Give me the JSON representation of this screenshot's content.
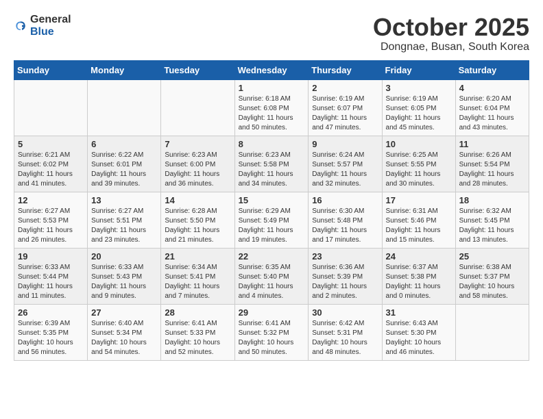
{
  "header": {
    "logo": {
      "general": "General",
      "blue": "Blue"
    },
    "title": "October 2025",
    "subtitle": "Dongnae, Busan, South Korea"
  },
  "calendar": {
    "days_of_week": [
      "Sunday",
      "Monday",
      "Tuesday",
      "Wednesday",
      "Thursday",
      "Friday",
      "Saturday"
    ],
    "weeks": [
      [
        {
          "day": "",
          "info": ""
        },
        {
          "day": "",
          "info": ""
        },
        {
          "day": "",
          "info": ""
        },
        {
          "day": "1",
          "info": "Sunrise: 6:18 AM\nSunset: 6:08 PM\nDaylight: 11 hours\nand 50 minutes."
        },
        {
          "day": "2",
          "info": "Sunrise: 6:19 AM\nSunset: 6:07 PM\nDaylight: 11 hours\nand 47 minutes."
        },
        {
          "day": "3",
          "info": "Sunrise: 6:19 AM\nSunset: 6:05 PM\nDaylight: 11 hours\nand 45 minutes."
        },
        {
          "day": "4",
          "info": "Sunrise: 6:20 AM\nSunset: 6:04 PM\nDaylight: 11 hours\nand 43 minutes."
        }
      ],
      [
        {
          "day": "5",
          "info": "Sunrise: 6:21 AM\nSunset: 6:02 PM\nDaylight: 11 hours\nand 41 minutes."
        },
        {
          "day": "6",
          "info": "Sunrise: 6:22 AM\nSunset: 6:01 PM\nDaylight: 11 hours\nand 39 minutes."
        },
        {
          "day": "7",
          "info": "Sunrise: 6:23 AM\nSunset: 6:00 PM\nDaylight: 11 hours\nand 36 minutes."
        },
        {
          "day": "8",
          "info": "Sunrise: 6:23 AM\nSunset: 5:58 PM\nDaylight: 11 hours\nand 34 minutes."
        },
        {
          "day": "9",
          "info": "Sunrise: 6:24 AM\nSunset: 5:57 PM\nDaylight: 11 hours\nand 32 minutes."
        },
        {
          "day": "10",
          "info": "Sunrise: 6:25 AM\nSunset: 5:55 PM\nDaylight: 11 hours\nand 30 minutes."
        },
        {
          "day": "11",
          "info": "Sunrise: 6:26 AM\nSunset: 5:54 PM\nDaylight: 11 hours\nand 28 minutes."
        }
      ],
      [
        {
          "day": "12",
          "info": "Sunrise: 6:27 AM\nSunset: 5:53 PM\nDaylight: 11 hours\nand 26 minutes."
        },
        {
          "day": "13",
          "info": "Sunrise: 6:27 AM\nSunset: 5:51 PM\nDaylight: 11 hours\nand 23 minutes."
        },
        {
          "day": "14",
          "info": "Sunrise: 6:28 AM\nSunset: 5:50 PM\nDaylight: 11 hours\nand 21 minutes."
        },
        {
          "day": "15",
          "info": "Sunrise: 6:29 AM\nSunset: 5:49 PM\nDaylight: 11 hours\nand 19 minutes."
        },
        {
          "day": "16",
          "info": "Sunrise: 6:30 AM\nSunset: 5:48 PM\nDaylight: 11 hours\nand 17 minutes."
        },
        {
          "day": "17",
          "info": "Sunrise: 6:31 AM\nSunset: 5:46 PM\nDaylight: 11 hours\nand 15 minutes."
        },
        {
          "day": "18",
          "info": "Sunrise: 6:32 AM\nSunset: 5:45 PM\nDaylight: 11 hours\nand 13 minutes."
        }
      ],
      [
        {
          "day": "19",
          "info": "Sunrise: 6:33 AM\nSunset: 5:44 PM\nDaylight: 11 hours\nand 11 minutes."
        },
        {
          "day": "20",
          "info": "Sunrise: 6:33 AM\nSunset: 5:43 PM\nDaylight: 11 hours\nand 9 minutes."
        },
        {
          "day": "21",
          "info": "Sunrise: 6:34 AM\nSunset: 5:41 PM\nDaylight: 11 hours\nand 7 minutes."
        },
        {
          "day": "22",
          "info": "Sunrise: 6:35 AM\nSunset: 5:40 PM\nDaylight: 11 hours\nand 4 minutes."
        },
        {
          "day": "23",
          "info": "Sunrise: 6:36 AM\nSunset: 5:39 PM\nDaylight: 11 hours\nand 2 minutes."
        },
        {
          "day": "24",
          "info": "Sunrise: 6:37 AM\nSunset: 5:38 PM\nDaylight: 11 hours\nand 0 minutes."
        },
        {
          "day": "25",
          "info": "Sunrise: 6:38 AM\nSunset: 5:37 PM\nDaylight: 10 hours\nand 58 minutes."
        }
      ],
      [
        {
          "day": "26",
          "info": "Sunrise: 6:39 AM\nSunset: 5:35 PM\nDaylight: 10 hours\nand 56 minutes."
        },
        {
          "day": "27",
          "info": "Sunrise: 6:40 AM\nSunset: 5:34 PM\nDaylight: 10 hours\nand 54 minutes."
        },
        {
          "day": "28",
          "info": "Sunrise: 6:41 AM\nSunset: 5:33 PM\nDaylight: 10 hours\nand 52 minutes."
        },
        {
          "day": "29",
          "info": "Sunrise: 6:41 AM\nSunset: 5:32 PM\nDaylight: 10 hours\nand 50 minutes."
        },
        {
          "day": "30",
          "info": "Sunrise: 6:42 AM\nSunset: 5:31 PM\nDaylight: 10 hours\nand 48 minutes."
        },
        {
          "day": "31",
          "info": "Sunrise: 6:43 AM\nSunset: 5:30 PM\nDaylight: 10 hours\nand 46 minutes."
        },
        {
          "day": "",
          "info": ""
        }
      ]
    ]
  }
}
